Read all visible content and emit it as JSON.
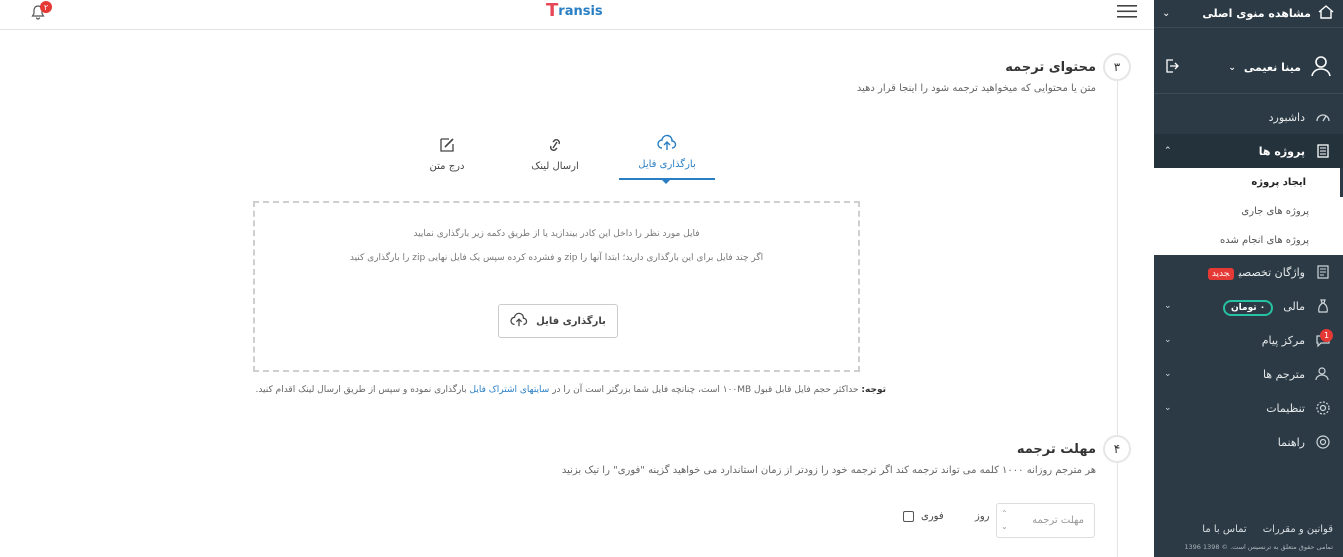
{
  "header": {
    "logo_prefix": "T",
    "logo_rest": "ransis",
    "notification_count": "۲"
  },
  "sidebar": {
    "top_link": "مشاهده منوی اصلی",
    "user_name": "مینا نعیمی",
    "items": [
      {
        "label": "داشبورد",
        "icon": "dashboard-icon"
      },
      {
        "label": "پروژه ها",
        "icon": "document-icon"
      },
      {
        "label": "واژگان تخصصی",
        "icon": "list-icon",
        "badge": "جدید"
      },
      {
        "label": "مالی",
        "icon": "money-bag-icon",
        "badge": "۰ تومان"
      },
      {
        "label": "مرکز پیام",
        "icon": "chat-icon",
        "badge": "1"
      },
      {
        "label": "مترجم ها",
        "icon": "users-icon"
      },
      {
        "label": "تنظیمات",
        "icon": "gear-icon"
      },
      {
        "label": "راهنما",
        "icon": "help-icon"
      }
    ],
    "subitems": [
      "ایجاد پروژه",
      "پروژه های جاری",
      "پروژه های انجام شده"
    ],
    "footer_links": [
      "قوانین و مقررات",
      "تماس با ما"
    ],
    "copyright": "تمامی حقوق متعلق به ترنسیس است. © 1398 1396"
  },
  "section3": {
    "number": "۳",
    "title": "محتوای ترجمه",
    "subtitle": "متن یا محتوایی که میخواهید ترجمه شود را اینجا قرار دهید",
    "tabs": [
      "بارگذاری فایل",
      "ارسال لینک",
      "درج متن"
    ],
    "dropzone_line1": "فایل مورد نظر را داخل این کادر بیندازید یا از طریق دکمه زیر بارگذاری نمایید",
    "dropzone_line2": "اگر چند فایل برای این بارگذاری دارید؛ ابتدا آنها را zip و فشرده کرده سپس یک فایل نهایی zip را بارگذاری کنید",
    "upload_button": "بارگذاری فایل",
    "note_label": "توجه:",
    "note_text_1": "حداکثر حجم فایل قابل قبول ۱۰۰MB است، چنانچه فایل شما بزرگتر است آن را در",
    "note_link": "سایتهای اشتراک فایل",
    "note_text_2": "بارگذاری نموده و سپس از طریق ارسال لینک اقدام کنید."
  },
  "section4": {
    "number": "۴",
    "title": "مهلت ترجمه",
    "subtitle": "هر مترجم روزانه ۱۰۰۰ کلمه می تواند ترجمه کند اگر ترجمه خود را زودتر از زمان استاندارد می خواهید گزینه \"فوری\" را تیک بزنید",
    "deadline_placeholder": "مهلت ترجمه",
    "unit": "روز",
    "urgent_label": "فوری"
  }
}
